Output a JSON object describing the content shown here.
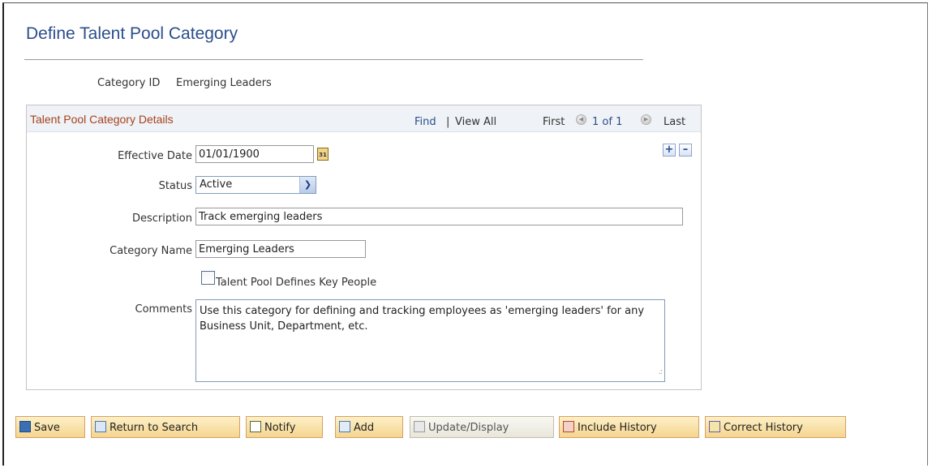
{
  "page": {
    "title": "Define Talent Pool Category",
    "category_id_label": "Category ID",
    "category_id_value": "Emerging Leaders"
  },
  "group": {
    "title": "Talent Pool Category Details",
    "find": "Find",
    "separator": "|",
    "view_all": "View All",
    "first": "First",
    "counter": "1 of 1",
    "last": "Last"
  },
  "form": {
    "effective_date_label": "Effective Date",
    "effective_date_value": "01/01/1900",
    "status_label": "Status",
    "status_value": "Active",
    "description_label": "Description",
    "description_value": "Track emerging leaders",
    "category_name_label": "Category Name",
    "category_name_value": "Emerging Leaders",
    "key_people_label": "Talent Pool Defines Key People",
    "key_people_checked": false,
    "comments_label": "Comments",
    "comments_value": "Use this category for defining and tracking employees as 'emerging leaders' for any Business Unit, Department, etc."
  },
  "toolbar": {
    "save": "Save",
    "return_to_search": "Return to Search",
    "notify": "Notify",
    "add": "Add",
    "update_display": "Update/Display",
    "include_history": "Include History",
    "correct_history": "Correct History"
  },
  "icons": {
    "calendar": "calendar-icon",
    "prev": "previous-row-icon",
    "next": "next-row-icon",
    "add_row": "add-row-icon",
    "delete_row": "delete-row-icon"
  },
  "colors": {
    "title_blue": "#2b4e8c",
    "group_title": "#a5421c",
    "button_fill": "#f5d58f",
    "button_border": "#d6a063"
  }
}
